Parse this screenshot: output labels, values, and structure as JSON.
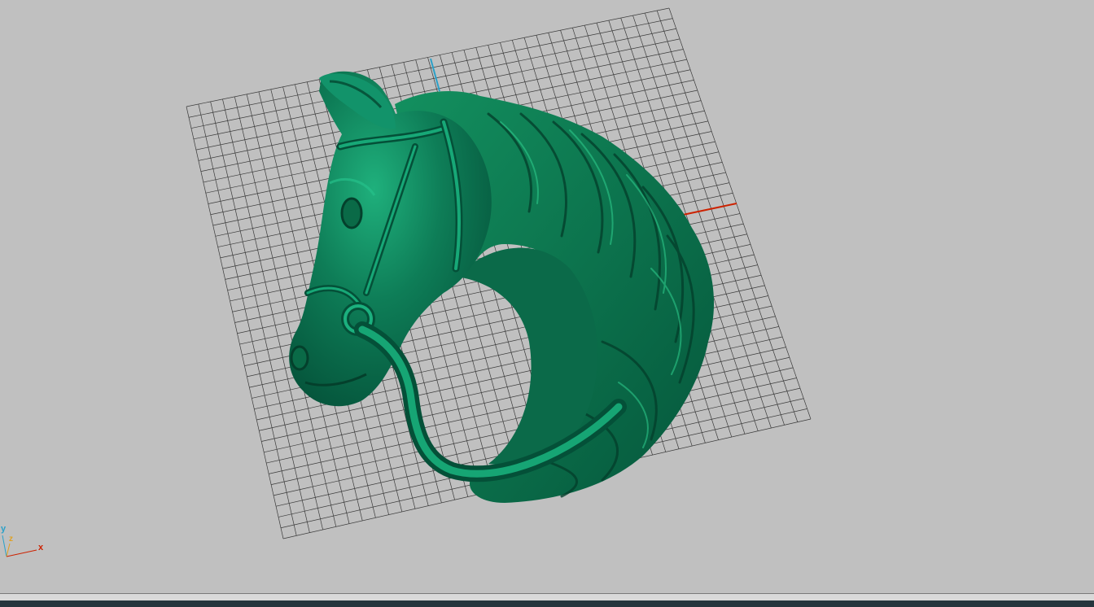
{
  "viewport": {
    "background": "#c0c0c0",
    "grid_color": "#3a3a3a",
    "model": {
      "name": "horse-head-relief",
      "color": "#0f7a55"
    }
  },
  "axes": {
    "x_label": "x",
    "y_label": "y",
    "z_label": "z",
    "x_color": "#cc2200",
    "y_color": "#2aa0c8",
    "z_color": "#e0a020"
  },
  "status_bar": {
    "color": "#25353d"
  }
}
